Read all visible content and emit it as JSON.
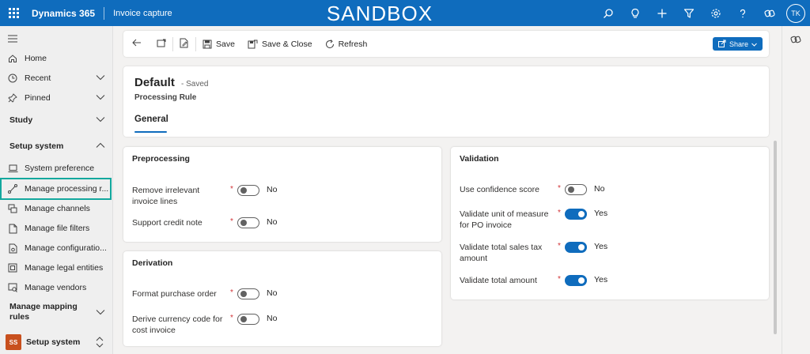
{
  "topbar": {
    "app_name": "Dynamics 365",
    "app_sub": "Invoice capture",
    "environment_banner": "SANDBOX",
    "user_initials": "TK"
  },
  "sidebar": {
    "items": [
      {
        "label": "Home",
        "icon": "home-icon"
      },
      {
        "label": "Recent",
        "icon": "clock-icon"
      },
      {
        "label": "Pinned",
        "icon": "pin-icon"
      }
    ],
    "groups": {
      "study": "Study",
      "setup_system": "Setup system",
      "manage_mapping_rules": "Manage mapping rules"
    },
    "setup_items": [
      {
        "label": "System preference",
        "icon": "laptop-icon"
      },
      {
        "label": "Manage processing r...",
        "icon": "flow-icon"
      },
      {
        "label": "Manage channels",
        "icon": "channels-icon"
      },
      {
        "label": "Manage file filters",
        "icon": "document-icon"
      },
      {
        "label": "Manage configuratio...",
        "icon": "document-settings-icon"
      },
      {
        "label": "Manage legal entities",
        "icon": "building-icon"
      },
      {
        "label": "Manage vendors",
        "icon": "vendor-icon"
      }
    ],
    "area": {
      "badge": "SS",
      "label": "Setup system"
    }
  },
  "commandbar": {
    "save": "Save",
    "save_close": "Save & Close",
    "refresh": "Refresh",
    "share": "Share"
  },
  "record": {
    "title": "Default",
    "status": "- Saved",
    "entity": "Processing Rule",
    "tab": "General"
  },
  "sections": {
    "preprocessing": {
      "title": "Preprocessing",
      "fields": [
        {
          "label": "Remove irrelevant invoice lines",
          "value": "No",
          "on": false
        },
        {
          "label": "Support credit note",
          "value": "No",
          "on": false
        }
      ]
    },
    "derivation": {
      "title": "Derivation",
      "fields": [
        {
          "label": "Format purchase order",
          "value": "No",
          "on": false
        },
        {
          "label": "Derive currency code for cost invoice",
          "value": "No",
          "on": false
        }
      ]
    },
    "validation": {
      "title": "Validation",
      "fields": [
        {
          "label": "Use confidence score",
          "value": "No",
          "on": false
        },
        {
          "label": "Validate unit of measure for PO invoice",
          "value": "Yes",
          "on": true
        },
        {
          "label": "Validate total sales tax amount",
          "value": "Yes",
          "on": true
        },
        {
          "label": "Validate total amount",
          "value": "Yes",
          "on": true
        }
      ]
    }
  },
  "colors": {
    "brand": "#0f6cbd",
    "active_outline": "#13a89e",
    "required": "#d13438"
  }
}
